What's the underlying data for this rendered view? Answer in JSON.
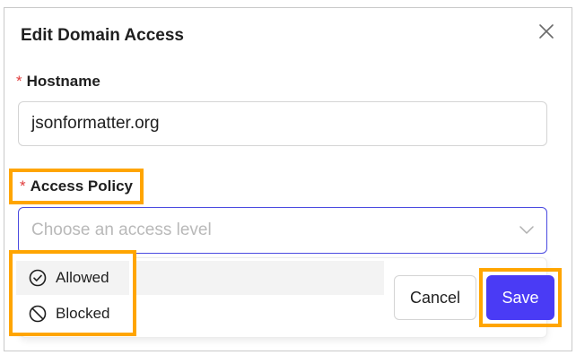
{
  "dialog": {
    "title": "Edit Domain Access",
    "close_icon": "close-icon"
  },
  "hostname": {
    "required_mark": "*",
    "label": "Hostname",
    "value": "jsonformatter.org"
  },
  "access_policy": {
    "required_mark": "*",
    "label": "Access Policy",
    "placeholder": "Choose an access level",
    "chevron_icon": "chevron-down-icon",
    "options": [
      {
        "label": "Allowed",
        "icon": "check-circle-icon"
      },
      {
        "label": "Blocked",
        "icon": "blocked-icon"
      }
    ]
  },
  "footer": {
    "cancel_label": "Cancel",
    "save_label": "Save"
  },
  "colors": {
    "primary": "#4a3bf5",
    "required": "#e03c3c",
    "highlight": "#ffa500",
    "focus_border": "#4a4ae0"
  }
}
